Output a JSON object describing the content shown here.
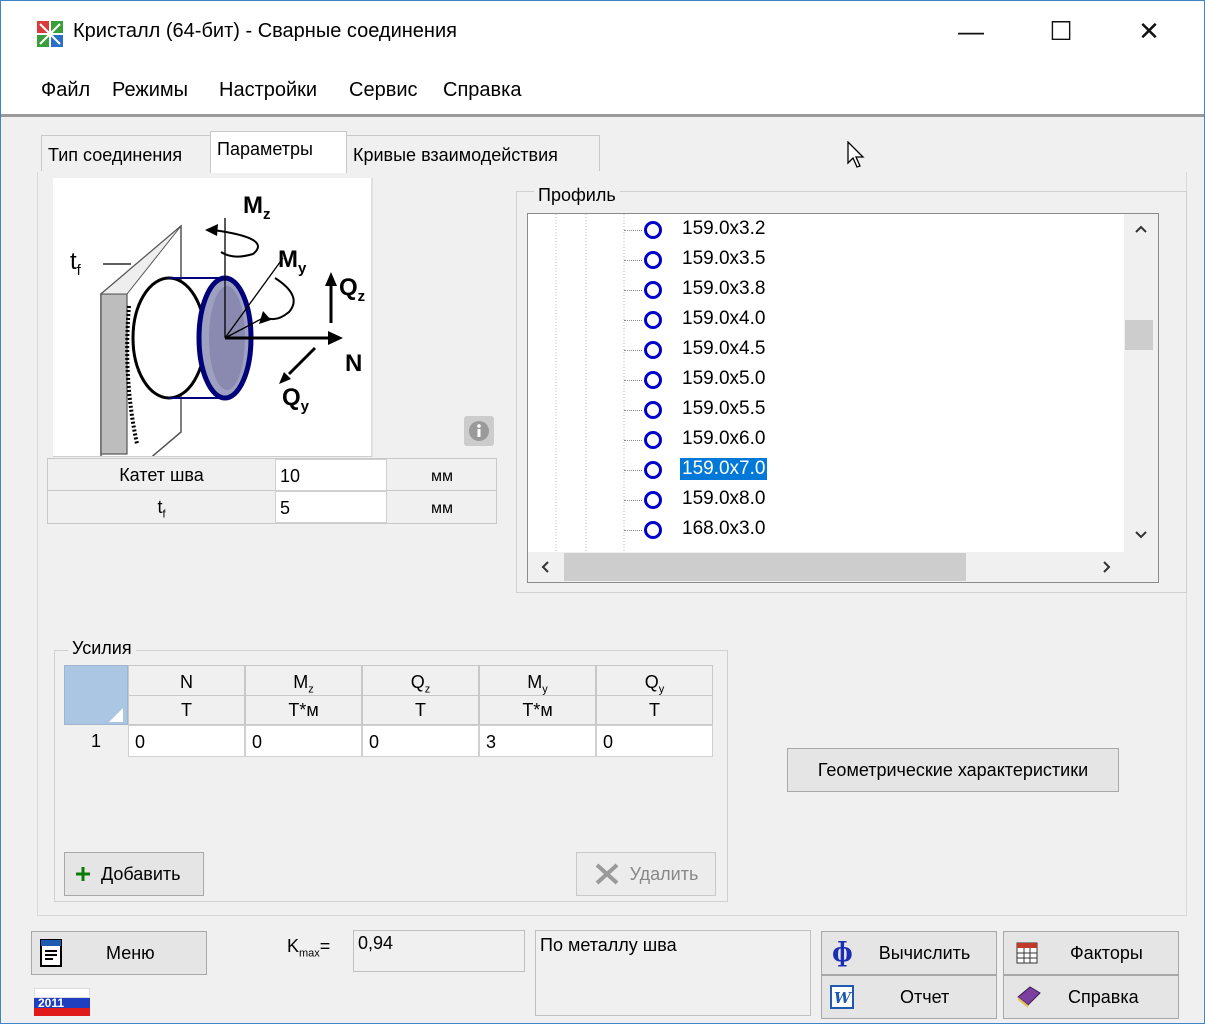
{
  "window": {
    "title": "Кристалл (64-бит) - Сварные соединения",
    "minimize": "—",
    "maximize": "☐",
    "close": "✕"
  },
  "menu": [
    "Файл",
    "Режимы",
    "Настройки",
    "Сервис",
    "Справка"
  ],
  "tabs": [
    "Тип соединения",
    "Параметры",
    "Кривые взаимодействия"
  ],
  "diagram": {
    "tf": "t",
    "tf_sub": "f",
    "mz": "M",
    "mz_sub": "z",
    "my": "M",
    "my_sub": "y",
    "qz": "Q",
    "qz_sub": "z",
    "n": "N",
    "qy": "Q",
    "qy_sub": "y"
  },
  "params": {
    "rows": [
      {
        "label": "Катет шва",
        "value": "10",
        "unit": "мм"
      },
      {
        "label": "t",
        "label_sub": "f",
        "value": "5",
        "unit": "мм"
      }
    ]
  },
  "profile": {
    "label": "Профиль",
    "items": [
      "159.0x3.2",
      "159.0x3.5",
      "159.0x3.8",
      "159.0x4.0",
      "159.0x4.5",
      "159.0x5.0",
      "159.0x5.5",
      "159.0x6.0",
      "159.0x7.0",
      "159.0x8.0",
      "168.0x3.0"
    ],
    "selected_index": 8,
    "scroll_left": "<",
    "scroll_right": ">",
    "scroll_up": "^",
    "scroll_down": "v"
  },
  "forces": {
    "label": "Усилия",
    "headers": [
      {
        "name": "N",
        "sub": "",
        "unit": "Т"
      },
      {
        "name": "M",
        "sub": "z",
        "unit": "Т*м"
      },
      {
        "name": "Q",
        "sub": "z",
        "unit": "Т"
      },
      {
        "name": "M",
        "sub": "y",
        "unit": "Т*м"
      },
      {
        "name": "Q",
        "sub": "y",
        "unit": "Т"
      }
    ],
    "rows": [
      {
        "num": "1",
        "values": [
          "0",
          "0",
          "0",
          "3",
          "0"
        ]
      }
    ],
    "add_label": "Добавить",
    "delete_label": "Удалить"
  },
  "geom_button": "Геометрические характеристики",
  "bottom": {
    "menu_label": "Меню",
    "year_badge": "2011",
    "kmax_label": "K",
    "kmax_sub": "max",
    "kmax_eq": "=",
    "kmax_value": "0,94",
    "result_text": "По металлу шва",
    "calc_label": "Вычислить",
    "factors_label": "Факторы",
    "report_label": "Отчет",
    "help_label": "Справка"
  },
  "colors": {
    "accent": "#0078d7",
    "circle": "#0000cc",
    "border": "#3f86c6"
  }
}
